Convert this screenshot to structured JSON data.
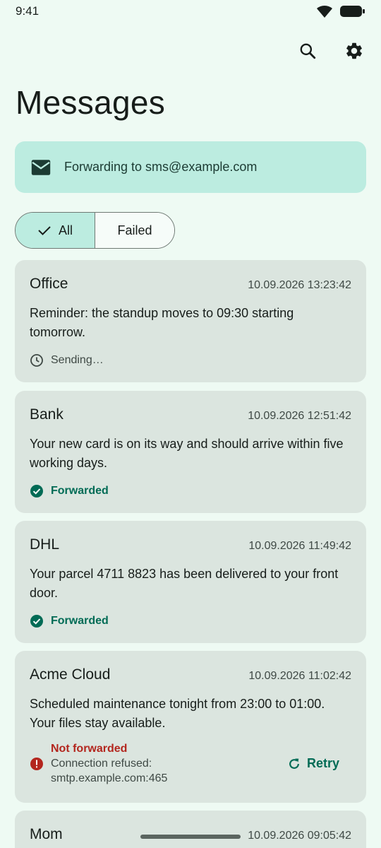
{
  "status_bar": {
    "time": "9:41"
  },
  "header": {
    "title": "Messages",
    "actions": [
      {
        "icon": "search-icon"
      },
      {
        "icon": "gear-icon"
      }
    ]
  },
  "banner": {
    "icon": "mail-icon",
    "text": "Forwarding to sms@example.com"
  },
  "filters": {
    "all_label": "All",
    "failed_label": "Failed",
    "selected": "All"
  },
  "messages": [
    {
      "sender": "Office",
      "time": "10.09.2026 13:23:42",
      "body": "Reminder: the standup moves to 09:30 starting tomorrow.",
      "status": "Sending…"
    },
    {
      "sender": "Bank",
      "time": "10.09.2026 12:51:42",
      "body": "Your new card is on its way and should arrive within five working days.",
      "status": "Forwarded"
    },
    {
      "sender": "DHL",
      "time": "10.09.2026 11:49:42",
      "body": "Your parcel 4711 8823 has been delivered to your front door.",
      "status": "Forwarded"
    },
    {
      "sender": "Acme Cloud",
      "time": "10.09.2026 11:02:42",
      "body": "Scheduled maintenance tonight from 23:00 to 01:00. Your files stay available.",
      "status": "Not forwarded",
      "error_line1": "Connection refused:",
      "error_line2": "smtp.example.com:465",
      "action": "Retry"
    },
    {
      "sender": "Mom",
      "time": "10.09.2026 09:05:42"
    }
  ],
  "colors": {
    "background": "#eefaf3",
    "card": "#dbe5df",
    "accent": "#006b55",
    "banner": "#bcece0",
    "error": "#b3261e"
  }
}
